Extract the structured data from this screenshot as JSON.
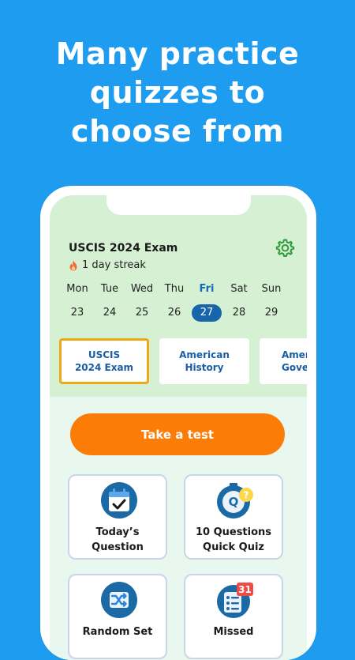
{
  "headline": [
    "Many practice",
    "quizzes to",
    "choose from"
  ],
  "header": {
    "exam_title": "USCIS 2024 Exam",
    "streak": "1 day streak"
  },
  "week": [
    {
      "name": "Mon",
      "num": "23"
    },
    {
      "name": "Tue",
      "num": "24"
    },
    {
      "name": "Wed",
      "num": "25"
    },
    {
      "name": "Thu",
      "num": "26"
    },
    {
      "name": "Fri",
      "num": "27"
    },
    {
      "name": "Sat",
      "num": "28"
    },
    {
      "name": "Sun",
      "num": "29"
    }
  ],
  "selected_day": "Fri",
  "categories": [
    {
      "line1": "USCIS",
      "line2": "2024 Exam"
    },
    {
      "line1": "American",
      "line2": "History"
    },
    {
      "line1": "American",
      "line2": "Government"
    }
  ],
  "take_test_label": "Take a test",
  "tiles": [
    {
      "line1": "Today’s",
      "line2": "Question",
      "icon": "calendar-check-icon"
    },
    {
      "line1": "10 Questions",
      "line2": "Quick Quiz",
      "icon": "stopwatch-quiz-icon"
    },
    {
      "line1": "Random Set",
      "line2": "",
      "icon": "shuffle-icon"
    },
    {
      "line1": "Missed",
      "line2": "",
      "icon": "missed-list-icon"
    }
  ],
  "missed_badge": "31",
  "colors": {
    "background": "#1e9cf0",
    "accent_orange": "#fb7d07",
    "selected_border": "#f0a716",
    "active_day": "#1766ab",
    "category_text": "#1a5da6"
  }
}
